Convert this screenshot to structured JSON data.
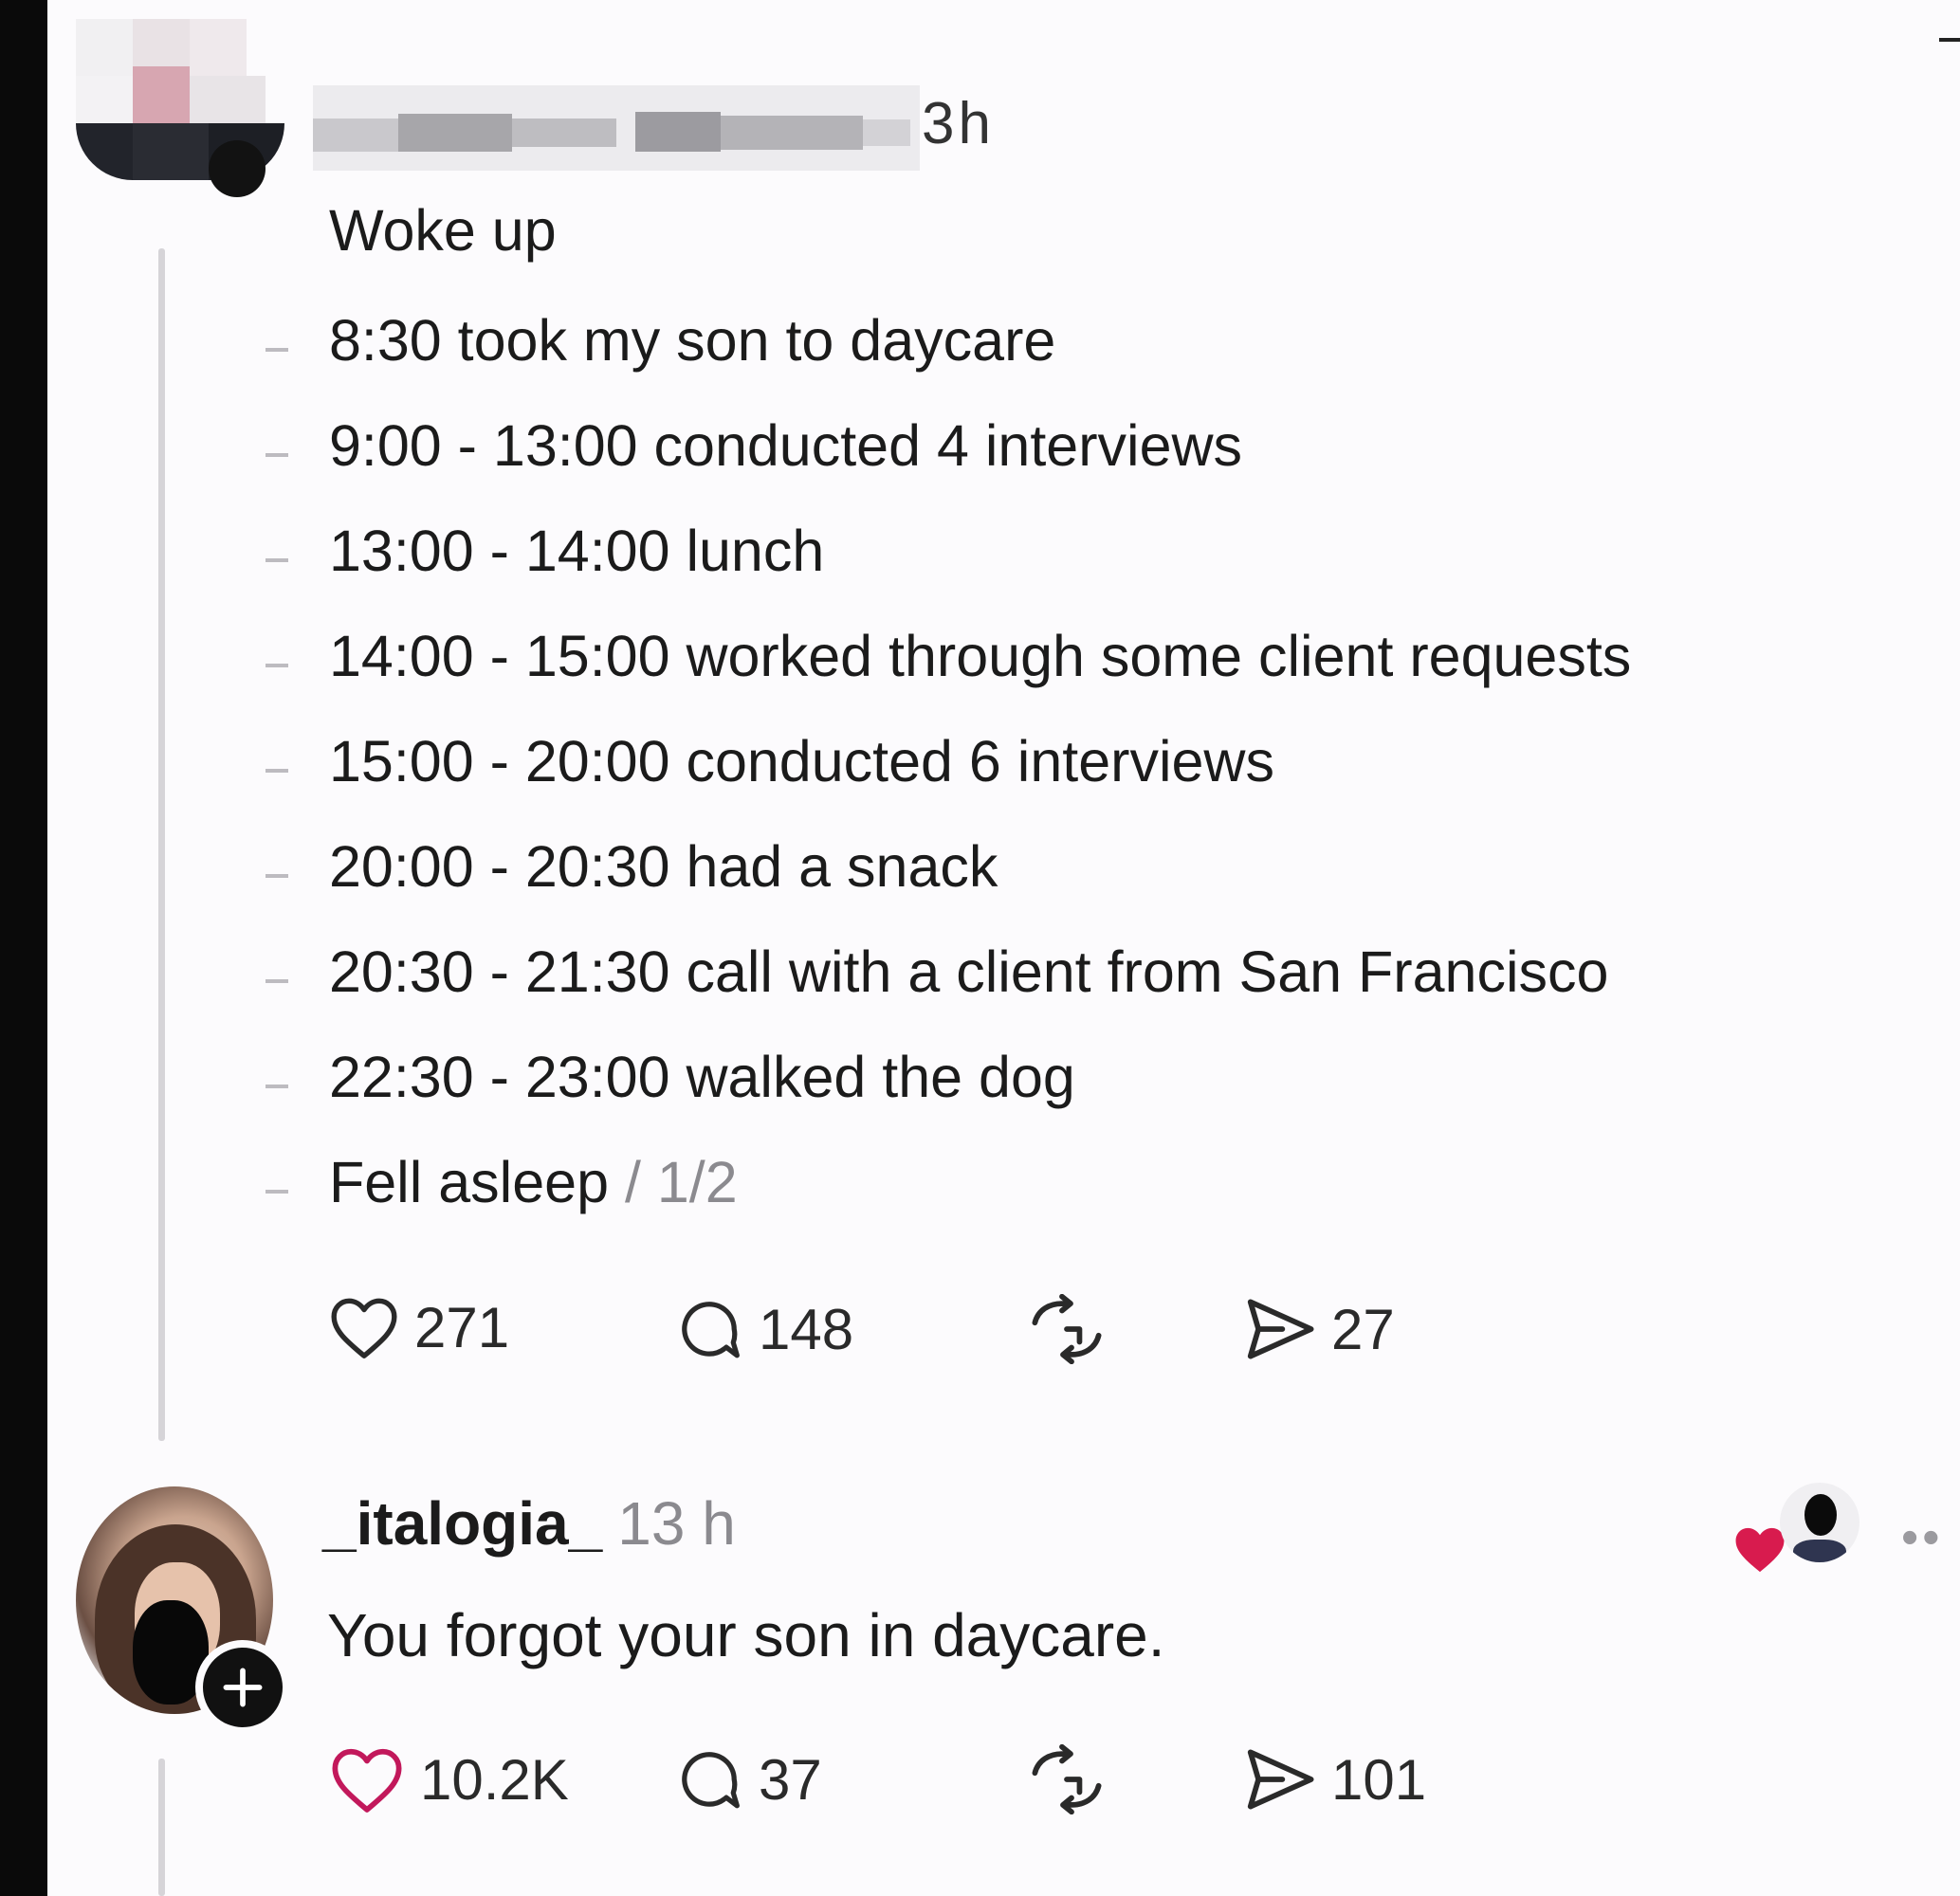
{
  "post": {
    "time": "3h",
    "lines": [
      "Woke up",
      "8:30 took my son to daycare",
      "9:00 - 13:00 conducted 4 interviews",
      "13:00 - 14:00 lunch",
      "14:00 - 15:00 worked through some client requests",
      "15:00 - 20:00 conducted 6 interviews",
      "20:00 - 20:30 had a snack",
      "20:30 - 21:30 call with a client from San Francisco",
      "22:30 - 23:00 walked the dog",
      "Fell asleep"
    ],
    "page_indicator": " / 1/2",
    "actions": {
      "likes": "271",
      "comments": "148",
      "shares": "27"
    }
  },
  "reply": {
    "username": "_italogia_",
    "time": "13 h",
    "text": "You forgot your son in daycare.",
    "actions": {
      "likes": "10.2K",
      "comments": "37",
      "shares": "101"
    }
  },
  "colors": {
    "background": "#fcfbfd",
    "text": "#1b1b1b",
    "muted": "#8b8a8f",
    "like_heart_reply": "#c2185b",
    "liked_by_heart": "#d81b4e"
  },
  "icons": [
    "heart-icon",
    "comment-icon",
    "repost-icon",
    "share-icon",
    "plus-icon",
    "more-icon"
  ]
}
